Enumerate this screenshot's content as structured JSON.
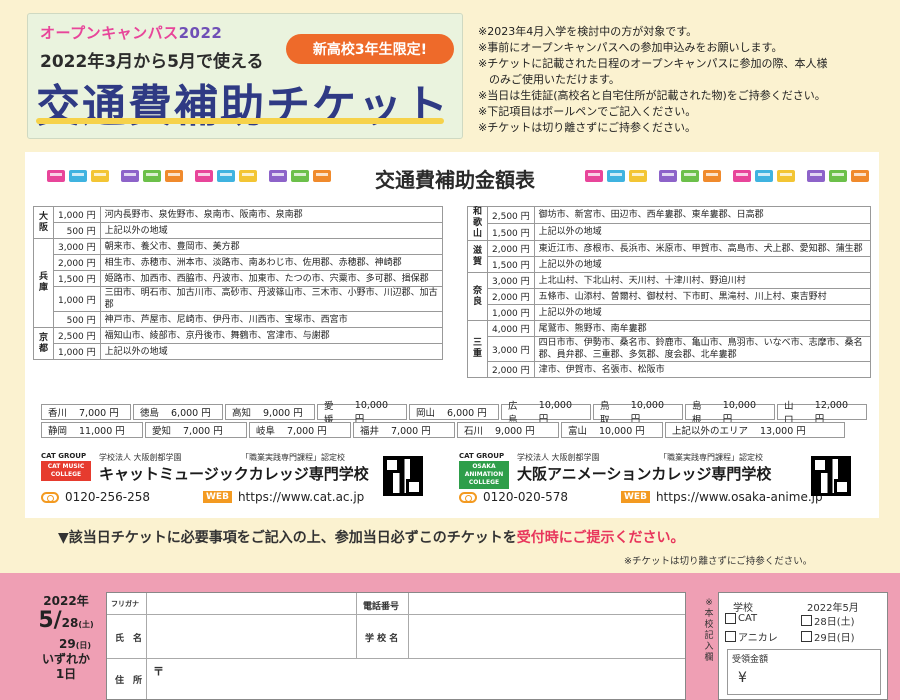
{
  "header": {
    "campaign_label": "オープンキャンパス",
    "campaign_year": "2022",
    "subtitle": "2022年3月から5月で使える",
    "title": "交通費補助チケット",
    "badge": "新高校3年生限定!"
  },
  "notes": [
    "※2023年4月入学を検討中の方が対象です。",
    "※事前にオープンキャンパスへの参加申込みをお願いします。",
    "※チケットに記載された日程のオープンキャンパスに参加の際、本人様",
    "　のみご使用いただけます。",
    "※当日は生徒証(高校名と自宅住所が記載された物)をご持参ください。",
    "※下記項目はボールペンでご記入ください。",
    "※チケットは切り離さずにご持参ください。"
  ],
  "fare_table_title": "交通費補助金額表",
  "left_table": [
    {
      "pref": "大阪",
      "rows": [
        {
          "amount": "1,000 円",
          "areas": "河内長野市、泉佐野市、泉南市、阪南市、泉南郡"
        },
        {
          "amount": "500 円",
          "areas": "上記以外の地域"
        }
      ]
    },
    {
      "pref": "兵庫",
      "rows": [
        {
          "amount": "3,000 円",
          "areas": "朝来市、養父市、豊岡市、美方郡"
        },
        {
          "amount": "2,000 円",
          "areas": "相生市、赤穂市、洲本市、淡路市、南あわじ市、佐用郡、赤穂郡、神崎郡"
        },
        {
          "amount": "1,500 円",
          "areas": "姫路市、加西市、西脇市、丹波市、加東市、たつの市、宍粟市、多可郡、揖保郡"
        },
        {
          "amount": "1,000 円",
          "areas": "三田市、明石市、加古川市、高砂市、丹波篠山市、三木市、小野市、川辺郡、加古郡"
        },
        {
          "amount": "500 円",
          "areas": "神戸市、芦屋市、尼崎市、伊丹市、川西市、宝塚市、西宮市"
        }
      ]
    },
    {
      "pref": "京都",
      "rows": [
        {
          "amount": "2,500 円",
          "areas": "福知山市、綾部市、京丹後市、舞鶴市、宮津市、与謝郡"
        },
        {
          "amount": "1,000 円",
          "areas": "上記以外の地域"
        }
      ]
    }
  ],
  "right_table": [
    {
      "pref": "和歌山",
      "rows": [
        {
          "amount": "2,500 円",
          "areas": "御坊市、新宮市、田辺市、西牟婁郡、東牟婁郡、日高郡"
        },
        {
          "amount": "1,500 円",
          "areas": "上記以外の地域"
        }
      ]
    },
    {
      "pref": "滋賀",
      "rows": [
        {
          "amount": "2,000 円",
          "areas": "東近江市、彦根市、長浜市、米原市、甲賀市、高島市、犬上郡、愛知郡、蒲生郡"
        },
        {
          "amount": "1,500 円",
          "areas": "上記以外の地域"
        }
      ]
    },
    {
      "pref": "奈良",
      "rows": [
        {
          "amount": "3,000 円",
          "areas": "上北山村、下北山村、天川村、十津川村、野迫川村"
        },
        {
          "amount": "2,000 円",
          "areas": "五條市、山添村、曽爾村、御杖村、下市町、黒滝村、川上村、東吉野村"
        },
        {
          "amount": "1,000 円",
          "areas": "上記以外の地域"
        }
      ]
    },
    {
      "pref": "三重",
      "rows": [
        {
          "amount": "4,000 円",
          "areas": "尾鷲市、熊野市、南牟婁郡"
        },
        {
          "amount": "3,000 円",
          "areas": "四日市市、伊勢市、桑名市、鈴鹿市、亀山市、鳥羽市、いなべ市、志摩市、桑名郡、員弁郡、三重郡、多気郡、度会郡、北牟婁郡"
        },
        {
          "amount": "2,000 円",
          "areas": "津市、伊賀市、名張市、松阪市"
        }
      ]
    }
  ],
  "other_prefs": [
    {
      "pref": "香川",
      "amount": "7,000 円"
    },
    {
      "pref": "徳島",
      "amount": "6,000 円"
    },
    {
      "pref": "高知",
      "amount": "9,000 円"
    },
    {
      "pref": "愛媛",
      "amount": "10,000 円"
    },
    {
      "pref": "岡山",
      "amount": "6,000 円"
    },
    {
      "pref": "広島",
      "amount": "10,000 円"
    },
    {
      "pref": "鳥取",
      "amount": "10,000 円"
    },
    {
      "pref": "島根",
      "amount": "10,000 円"
    },
    {
      "pref": "山口",
      "amount": "12,000 円"
    },
    {
      "pref": "静岡",
      "amount": "11,000 円"
    },
    {
      "pref": "愛知",
      "amount": "7,000 円"
    },
    {
      "pref": "岐阜",
      "amount": "7,000 円"
    },
    {
      "pref": "福井",
      "amount": "7,000 円"
    },
    {
      "pref": "石川",
      "amount": "9,000 円"
    },
    {
      "pref": "富山",
      "amount": "10,000 円"
    },
    {
      "pref": "上記以外のエリア",
      "amount": "13,000 円"
    }
  ],
  "schools": [
    {
      "group": "CAT GROUP",
      "logo_text": "CAT MUSIC COLLEGE",
      "org": "学校法人 大阪創都学園",
      "cert": "「職業実践専門課程」認定校",
      "name": "キャットミュージックカレッジ専門学校",
      "tel": "0120-256-258",
      "web_label": "WEB",
      "url": "https://www.cat.ac.jp",
      "logo_color": "#e63b2e"
    },
    {
      "group": "CAT GROUP",
      "logo_text": "OSAKA ANIMATION COLLEGE",
      "org": "学校法人 大阪創都学園",
      "cert": "「職業実践専門課程」認定校",
      "name": "大阪アニメーションカレッジ専門学校",
      "tel": "0120-020-578",
      "web_label": "WEB",
      "url": "https://www.osaka-anime.jp",
      "logo_color": "#2e9e4a"
    }
  ],
  "instruction": {
    "prefix": "▼該当日チケットに必要事項をご記入の上、参加当日必ずこのチケットを",
    "highlight": "受付時にご提示ください。",
    "note": "※チケットは切り離さずにご持参ください。"
  },
  "ticket": {
    "year": "2022年",
    "month": "5/",
    "day1": "28",
    "day1_dow": "(土)",
    "day2": "29",
    "day2_dow": "(日)",
    "pick1": "いずれか",
    "pick2": "1日",
    "furigana_label": "フリガナ",
    "name_label": "氏　名",
    "address_label": "住　所",
    "postal_mark": "〒",
    "phone_label": "電話番号",
    "school_label": "学 校 名",
    "stub_side_label": "※本校記入欄",
    "stub_school_label": "学校",
    "stub_date_label": "2022年5月",
    "opt_cat": "CAT",
    "opt_anime": "アニカレ",
    "opt_day1": "28日(土)",
    "opt_day2": "29日(日)",
    "amount_label": "受領金額",
    "yen_mark": "¥"
  },
  "colors": {
    "background": "#fbf2d0",
    "ticket_pink": "#ef9fb4",
    "title_blue": "#2f3a84",
    "badge_orange": "#ee6a2a",
    "highlight_red": "#e8365c",
    "train_colors": [
      "#e8459a",
      "#3fb3e0",
      "#f3c534",
      "#8d63c9",
      "#6cc04a",
      "#f08a2c"
    ]
  }
}
